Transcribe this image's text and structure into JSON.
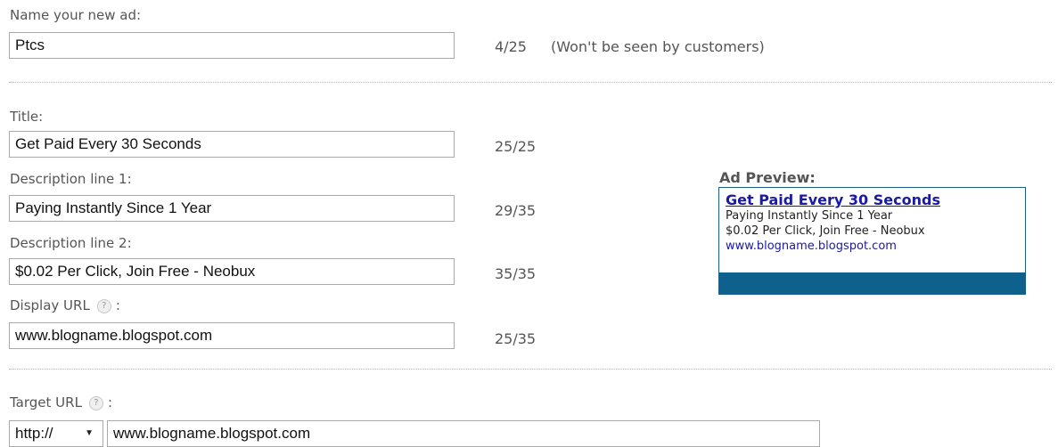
{
  "ad_name": {
    "label": "Name your new ad:",
    "value": "Ptcs",
    "counter": "4/25",
    "note": "(Won't be seen by customers)"
  },
  "title": {
    "label": "Title:",
    "value": "Get Paid Every 30 Seconds",
    "counter": "25/25"
  },
  "description1": {
    "label": "Description line 1:",
    "value": "Paying Instantly Since 1 Year",
    "counter": "29/35"
  },
  "description2": {
    "label": "Description line 2:",
    "value": "$0.02 Per Click, Join Free - Neobux",
    "counter": "35/35"
  },
  "display_url": {
    "label": "Display URL",
    "label_suffix": ":",
    "help_icon": "?",
    "value": "www.blogname.blogspot.com",
    "counter": "25/35"
  },
  "target_url": {
    "label": "Target URL",
    "label_suffix": ":",
    "help_icon": "?",
    "protocol": "http://",
    "value": "www.blogname.blogspot.com"
  },
  "preview": {
    "heading": "Ad Preview:",
    "title": "Get Paid Every 30 Seconds",
    "line1": "Paying Instantly Since 1 Year",
    "line2": "$0.02 Per Click, Join Free - Neobux",
    "url": "www.blogname.blogspot.com",
    "bar_color": "#0f618d",
    "link_color": "#1a1aa6"
  }
}
